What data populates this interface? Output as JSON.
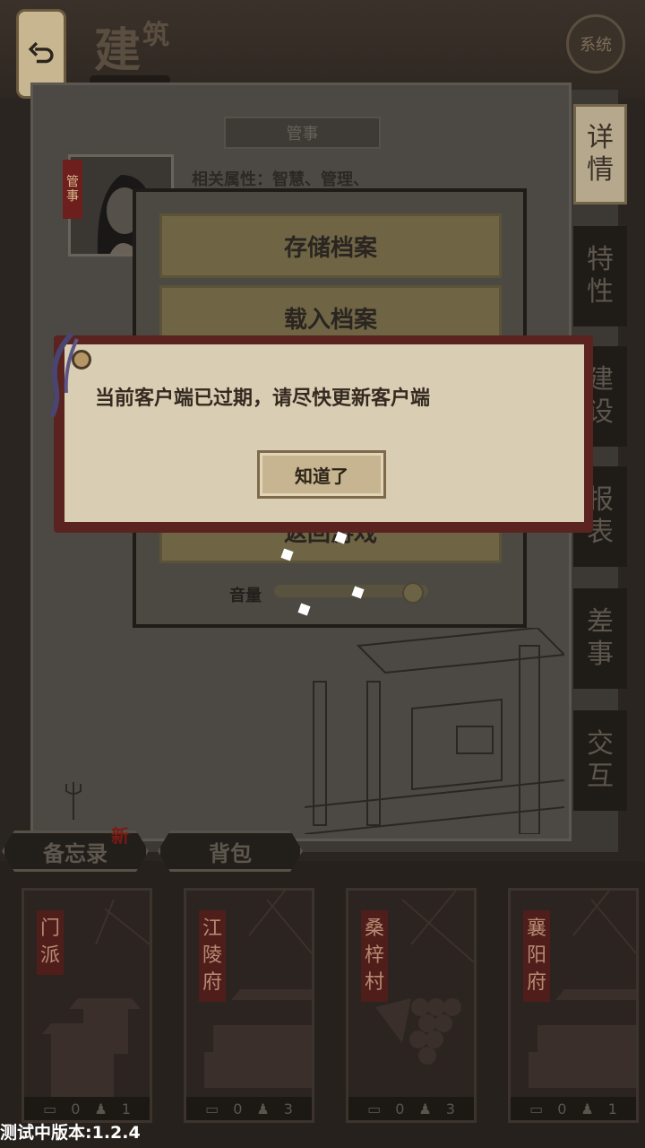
{
  "header": {
    "title_main": "建",
    "title_sub": "筑",
    "system_button": "系统"
  },
  "panel": {
    "ribbon_label": "管事",
    "portrait_tag": "管事",
    "attributes": "相关属性：智慧、管理、"
  },
  "side_tabs": [
    {
      "label": "详情",
      "active": true
    },
    {
      "label": "特性",
      "active": false
    },
    {
      "label": "建设",
      "active": false
    },
    {
      "label": "报表",
      "active": false
    },
    {
      "label": "差事",
      "active": false
    },
    {
      "label": "交互",
      "active": false
    }
  ],
  "menu": {
    "save": "存储档案",
    "load": "载入档案",
    "return": "返回游戏",
    "volume_label": "音量",
    "volume": 0.9
  },
  "dialog": {
    "message": "当前客户端已过期，请尽快更新客户端",
    "ok_button": "知道了"
  },
  "bottom_tabs": {
    "memo": "备忘录",
    "memo_badge": "新",
    "bag": "背包"
  },
  "cards": [
    {
      "name": "门派",
      "scrolls": "0",
      "people": "1"
    },
    {
      "name": "江陵府",
      "scrolls": "0",
      "people": "3"
    },
    {
      "name": "桑梓村",
      "scrolls": "0",
      "people": "3"
    },
    {
      "name": "襄阳府",
      "scrolls": "0",
      "people": "1"
    }
  ],
  "version": "测试中版本:1.2.4",
  "colors": {
    "dialog_border": "#5a231f",
    "dialog_bg": "#d9cdb3",
    "active_tab": "#b5a88d",
    "card_label": "#4f1e1a"
  }
}
